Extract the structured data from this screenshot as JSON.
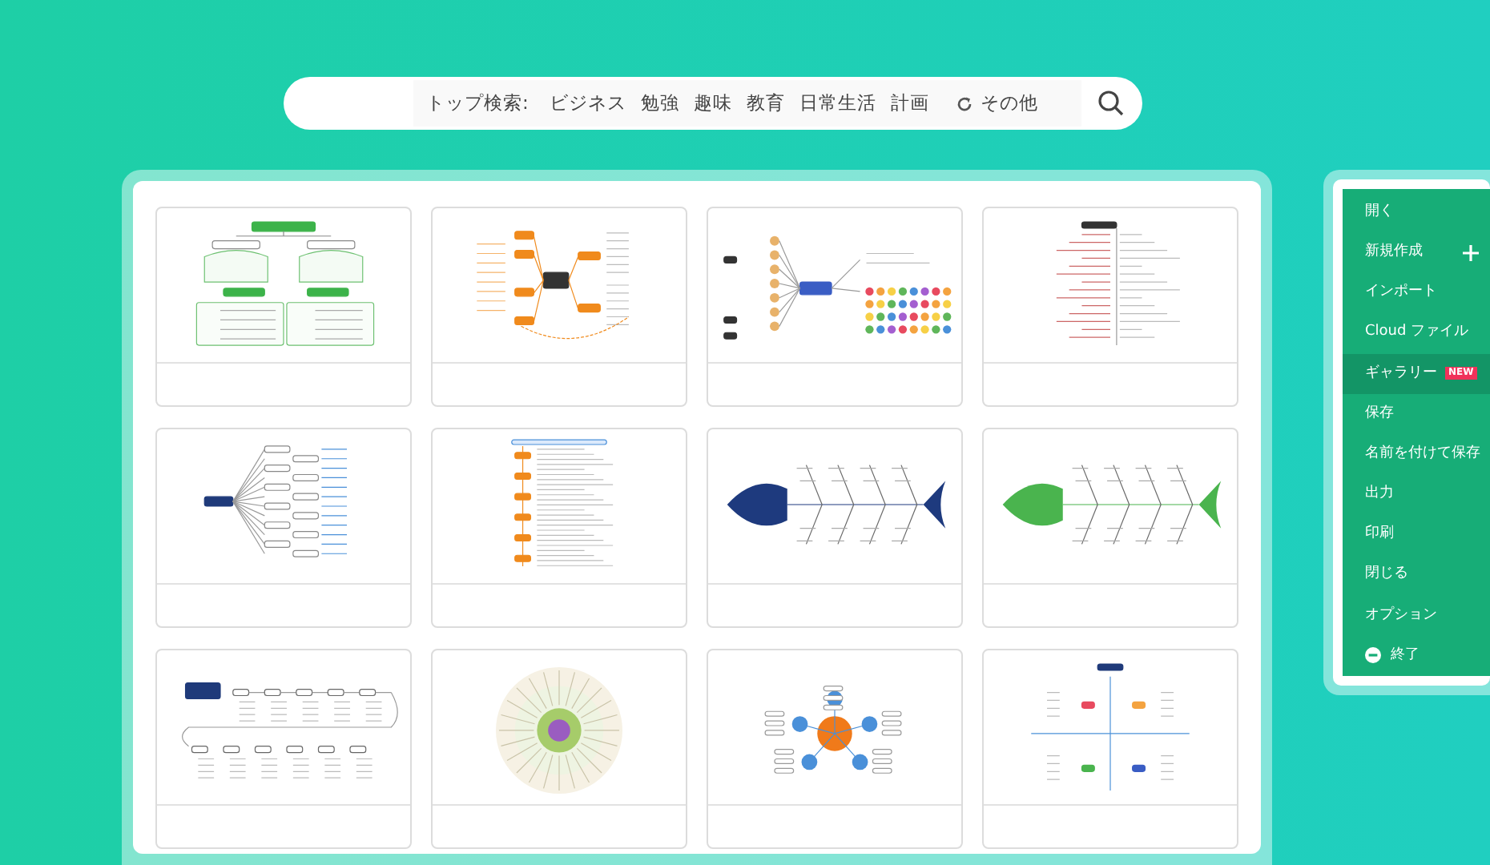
{
  "search": {
    "label": "トップ検索:",
    "tags": [
      "ビジネス",
      "勉強",
      "趣味",
      "教育",
      "日常生活",
      "計画"
    ],
    "more": "その他"
  },
  "gallery": {
    "cards": [
      {
        "kind": "tree"
      },
      {
        "kind": "orange-mind"
      },
      {
        "kind": "icon-mind"
      },
      {
        "kind": "outline"
      },
      {
        "kind": "org"
      },
      {
        "kind": "list"
      },
      {
        "kind": "fishbone-blue"
      },
      {
        "kind": "fishbone-green"
      },
      {
        "kind": "timeline"
      },
      {
        "kind": "radial"
      },
      {
        "kind": "bubble"
      },
      {
        "kind": "quadrant"
      }
    ]
  },
  "menu": {
    "items": [
      {
        "label": "開く",
        "selected": false
      },
      {
        "label": "新規作成",
        "selected": false,
        "kind": "add"
      },
      {
        "label": "インポート",
        "selected": false
      },
      {
        "label": "Cloud ファイル",
        "selected": false
      },
      {
        "label": "ギャラリー",
        "selected": true,
        "badge": "NEW"
      },
      {
        "label": "保存",
        "selected": false
      },
      {
        "label": "名前を付けて保存",
        "selected": false
      },
      {
        "label": "出力",
        "selected": false
      },
      {
        "label": "印刷",
        "selected": false
      },
      {
        "label": "閉じる",
        "selected": false
      },
      {
        "label": "オプション",
        "selected": false
      },
      {
        "label": "終了",
        "selected": false,
        "kind": "exit"
      }
    ]
  }
}
